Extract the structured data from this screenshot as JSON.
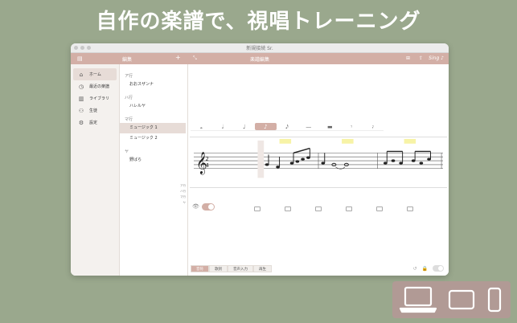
{
  "headline": "自作の楽譜で、視唱トレーニング",
  "window": {
    "title": "新規接続 Sr."
  },
  "toolbar": {
    "left_label": "編集",
    "center_title": "楽譜編集",
    "right_label": "Sing ♪"
  },
  "sidebar": {
    "items": [
      {
        "icon": "home-icon",
        "label": "ホーム",
        "active": true
      },
      {
        "icon": "clock-icon",
        "label": "最近の楽譜"
      },
      {
        "icon": "book-icon",
        "label": "ライブラリ"
      },
      {
        "icon": "people-icon",
        "label": "生徒"
      },
      {
        "icon": "gear-icon",
        "label": "設定"
      }
    ]
  },
  "list": {
    "groups": [
      {
        "header": "ア行",
        "items": [
          "おおスザンナ"
        ]
      },
      {
        "header": "ハ行",
        "items": [
          "ハレルヤ"
        ]
      },
      {
        "header": "マ行",
        "items": [
          "ミュージック 1",
          "ミュージック 2"
        ]
      },
      {
        "header": "ヤ",
        "items": [
          "野ばら"
        ]
      }
    ],
    "selected": "ミュージック 1",
    "index_letters": "ア行\nハ行\nマ行\nヤ"
  },
  "notebar": {
    "items": [
      "𝅝",
      "𝅗𝅥",
      "♩",
      "♪",
      "𝅘𝅥𝅯",
      "—",
      "▬",
      "𝄾",
      "𝄿"
    ],
    "selected": 3
  },
  "bottom_tabs": [
    "音符",
    "歌詞",
    "音声入力",
    "再生"
  ],
  "bottom_selected": 0,
  "colors": {
    "accent": "#d3afa6",
    "background": "#9aa88d",
    "highlight": "#f7f3a6"
  }
}
